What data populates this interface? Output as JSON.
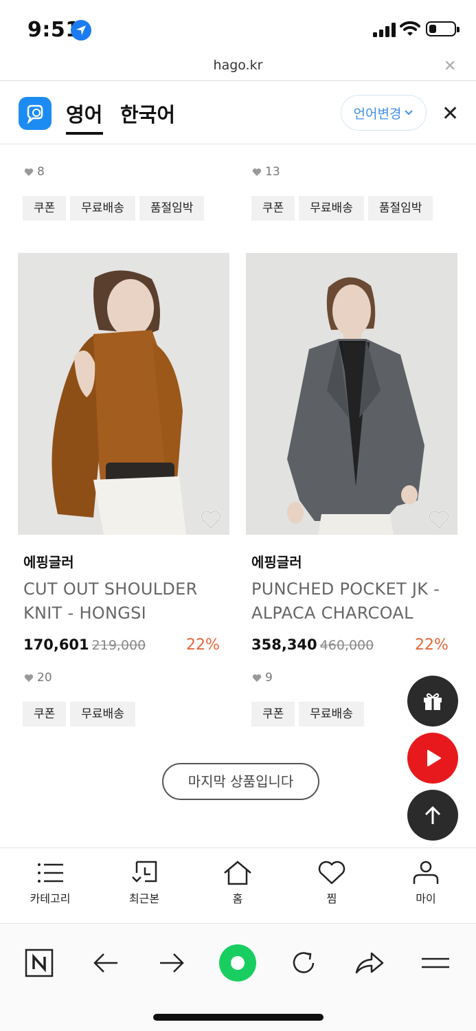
{
  "status": {
    "time": "9:51"
  },
  "browser": {
    "url": "hago.kr"
  },
  "translate_bar": {
    "lang_selected": "영어",
    "lang_other": "한국어",
    "change_label": "언어변경"
  },
  "products_top": [
    {
      "likes": "8",
      "tags": [
        "쿠폰",
        "무료배송",
        "품절임박"
      ]
    },
    {
      "likes": "13",
      "tags": [
        "쿠폰",
        "무료배송",
        "품절임박"
      ]
    }
  ],
  "products": [
    {
      "brand": "에핑글러",
      "name": "CUT OUT SHOULDER KNIT - HONGSI",
      "price": "170,601",
      "original_price": "219,000",
      "discount": "22%",
      "likes": "20",
      "tags": [
        "쿠폰",
        "무료배송"
      ]
    },
    {
      "brand": "에핑글러",
      "name": "PUNCHED POCKET JK - ALPACA CHARCOAL",
      "price": "358,340",
      "original_price": "460,000",
      "discount": "22%",
      "likes": "9",
      "tags": [
        "쿠폰",
        "무료배송"
      ]
    }
  ],
  "last_item_label": "마지막 상품입니다",
  "site_nav": [
    {
      "label": "카테고리",
      "icon": "list-icon"
    },
    {
      "label": "최근본",
      "icon": "recent-icon"
    },
    {
      "label": "홈",
      "icon": "home-icon"
    },
    {
      "label": "찜",
      "icon": "heart-icon"
    },
    {
      "label": "마이",
      "icon": "person-icon"
    }
  ],
  "colors": {
    "accent": "#1d8cf2",
    "discount": "#e7663a",
    "youtube": "#e8191c",
    "naver": "#19ce60"
  }
}
